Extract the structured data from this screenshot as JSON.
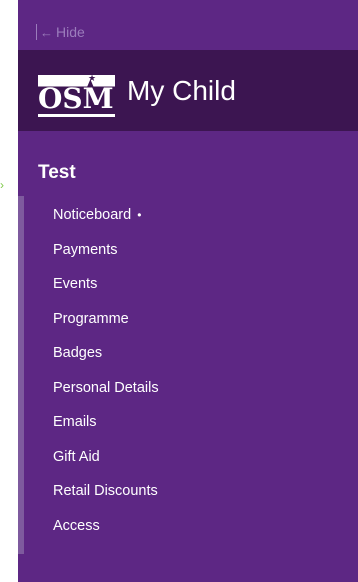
{
  "hide": {
    "label": "Hide",
    "icon": "arrow-left-icon"
  },
  "brand": {
    "logo_text": "OSM",
    "title": "My Child"
  },
  "section": {
    "title": "Test"
  },
  "nav": {
    "items": [
      {
        "label": "Noticeboard",
        "dot": "•"
      },
      {
        "label": "Payments"
      },
      {
        "label": "Events"
      },
      {
        "label": "Programme"
      },
      {
        "label": "Badges"
      },
      {
        "label": "Personal Details"
      },
      {
        "label": "Emails"
      },
      {
        "label": "Gift Aid"
      },
      {
        "label": "Retail Discounts"
      },
      {
        "label": "Access"
      }
    ]
  },
  "colors": {
    "panel": "#5d2784",
    "brand_bar": "#3c1551",
    "pointer": "#7fc94a"
  }
}
